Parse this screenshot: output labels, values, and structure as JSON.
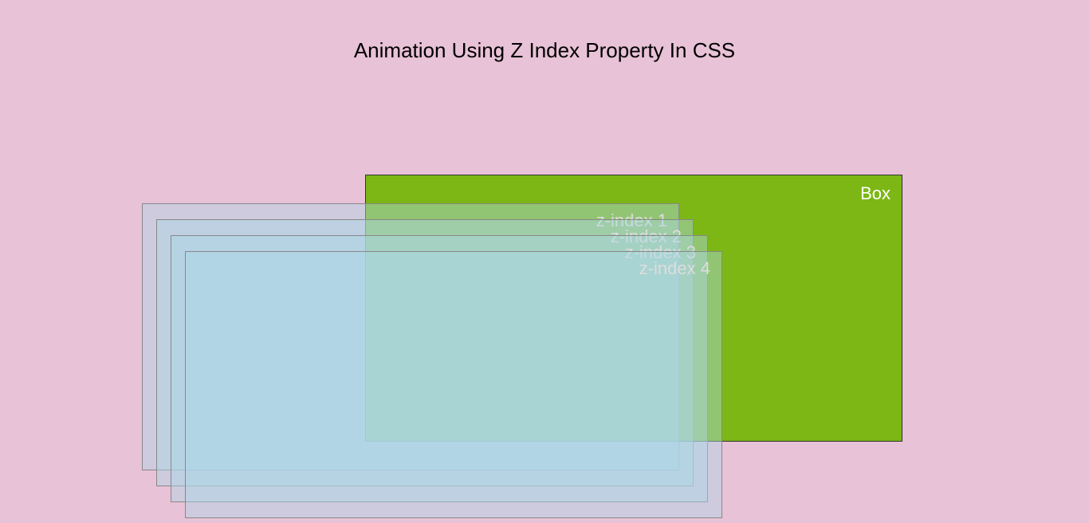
{
  "title": "Animation Using Z Index Property In CSS",
  "green_box": {
    "label": "Box",
    "color": "#7cb715"
  },
  "z_boxes": [
    {
      "label": "z-index 1"
    },
    {
      "label": "z-index 2"
    },
    {
      "label": "z-index 3"
    },
    {
      "label": "z-index 4"
    }
  ],
  "colors": {
    "background": "#e8c2d6",
    "overlay_box": "rgba(173, 216, 230, 0.45)"
  },
  "chart_data": {
    "type": "diagram",
    "title": "Animation Using Z Index Property In CSS",
    "description": "Demonstration of CSS z-index stacking with one opaque green box and four semi-transparent light-blue boxes layered in front of it with increasing z-index values.",
    "elements": [
      {
        "name": "Box",
        "z_index": 1,
        "color": "#7cb715",
        "opacity": 1.0
      },
      {
        "name": "z-index 1",
        "z_index": 2,
        "color": "lightblue",
        "opacity": 0.45
      },
      {
        "name": "z-index 2",
        "z_index": 3,
        "color": "lightblue",
        "opacity": 0.45
      },
      {
        "name": "z-index 3",
        "z_index": 4,
        "color": "lightblue",
        "opacity": 0.45
      },
      {
        "name": "z-index 4",
        "z_index": 5,
        "color": "lightblue",
        "opacity": 0.45
      }
    ]
  }
}
